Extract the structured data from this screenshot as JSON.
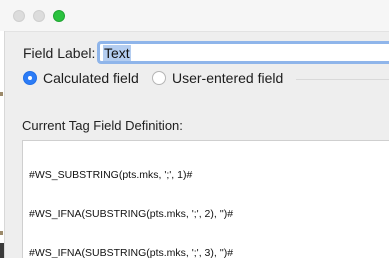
{
  "field_label": {
    "label": "Field Label:",
    "value": "Text"
  },
  "radios": [
    {
      "label": "Calculated field",
      "selected": true
    },
    {
      "label": "User-entered field",
      "selected": false
    }
  ],
  "definition": {
    "label": "Current Tag Field Definition:",
    "lines": [
      "#WS_SUBSTRING(pts.mks, ';', 1)#",
      "#WS_IFNA(SUBSTRING(pts.mks, ';', 2), '')#",
      "#WS_IFNA(SUBSTRING(pts.mks, ';', 3), '')#"
    ]
  },
  "colors": {
    "accent": "#2c7cf6",
    "focus_ring": "#8fb5ea",
    "selection": "#b4cdf0",
    "zoom_button": "#2bc23f"
  },
  "icons": {
    "close": "close-window-icon",
    "minimize": "minimize-window-icon",
    "zoom": "zoom-window-icon"
  }
}
